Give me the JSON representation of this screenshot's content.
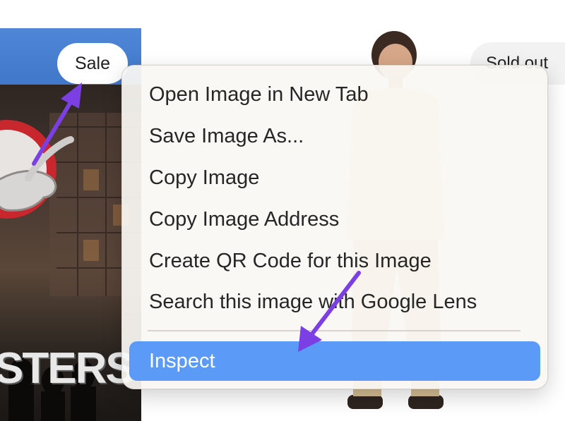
{
  "product_cards": {
    "left": {
      "badge": "Sale",
      "poster_text": "STERS"
    },
    "right": {
      "badge": "Sold out"
    }
  },
  "context_menu": {
    "items": [
      {
        "label": "Open Image in New Tab"
      },
      {
        "label": "Save Image As..."
      },
      {
        "label": "Copy Image"
      },
      {
        "label": "Copy Image Address"
      },
      {
        "label": "Create QR Code for this Image"
      },
      {
        "label": "Search this image with Google Lens"
      },
      {
        "label": "Inspect",
        "highlighted": true
      }
    ],
    "highlight_color": "#5b9bf7"
  },
  "annotations": {
    "arrow_color": "#7b3fe4"
  }
}
